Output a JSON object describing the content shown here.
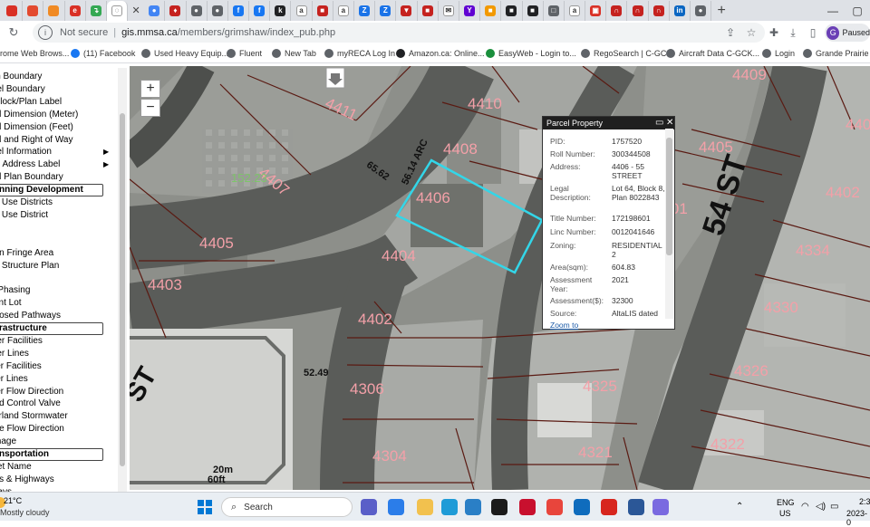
{
  "browser": {
    "url_prefix": "gis.mmsa.ca",
    "url_path": "/members/grimshaw/index_pub.php",
    "security_label": "Not secure",
    "profile_letter": "G",
    "profile_status": "Paused",
    "tabs": [
      {
        "icon": "bookmark-tab-icon",
        "color": "#d93025",
        "char": ""
      },
      {
        "icon": "red-tab-icon",
        "color": "#e34a2f",
        "char": ""
      },
      {
        "icon": "orange-tab-icon",
        "color": "#f08a24",
        "char": ""
      },
      {
        "icon": "red-e-tab-icon",
        "color": "#d93025",
        "char": "e"
      },
      {
        "icon": "green-tab-icon",
        "color": "#34a853",
        "char": "↴"
      },
      {
        "icon": "loading-tab-icon",
        "color": "#ffffff",
        "char": "◌"
      },
      {
        "icon": "maps-tab-icon",
        "color": "#4285f4",
        "char": "●"
      },
      {
        "icon": "red-leaf-tab-icon",
        "color": "#c5221f",
        "char": "♦"
      },
      {
        "icon": "grey-tab-icon",
        "color": "#5f6368",
        "char": "●"
      },
      {
        "icon": "grey-tab-icon",
        "color": "#5f6368",
        "char": "●"
      },
      {
        "icon": "facebook-tab-icon",
        "color": "#1877f2",
        "char": "f"
      },
      {
        "icon": "facebook-tab-icon",
        "color": "#1877f2",
        "char": "f"
      },
      {
        "icon": "k-tab-icon",
        "color": "#202124",
        "char": "k"
      },
      {
        "icon": "amazon-tab-icon",
        "color": "#ffffff",
        "char": "a"
      },
      {
        "icon": "red-square-tab-icon",
        "color": "#c5221f",
        "char": "■"
      },
      {
        "icon": "amazon-tab-icon",
        "color": "#ffffff",
        "char": "a"
      },
      {
        "icon": "z-tab-icon",
        "color": "#1a73e8",
        "char": "Z"
      },
      {
        "icon": "z-tab-icon",
        "color": "#1a73e8",
        "char": "Z"
      },
      {
        "icon": "triangle-tab-icon",
        "color": "#c5221f",
        "char": "▼"
      },
      {
        "icon": "red-square-tab-icon",
        "color": "#c5221f",
        "char": "■"
      },
      {
        "icon": "mail-tab-icon",
        "color": "#ffffff",
        "char": "✉"
      },
      {
        "icon": "yahoo-tab-icon",
        "color": "#6001d2",
        "char": "Y"
      },
      {
        "icon": "orange-square-tab-icon",
        "color": "#f29900",
        "char": "■"
      },
      {
        "icon": "cube-tab-icon",
        "color": "#202124",
        "char": "■"
      },
      {
        "icon": "cube-tab-icon",
        "color": "#202124",
        "char": "■"
      },
      {
        "icon": "doc-tab-icon",
        "color": "#5f6368",
        "char": "□"
      },
      {
        "icon": "amazon-tab-icon",
        "color": "#ffffff",
        "char": "a"
      },
      {
        "icon": "red-tab-icon",
        "color": "#d93025",
        "char": "▣"
      },
      {
        "icon": "red-arc-tab-icon",
        "color": "#c5221f",
        "char": "∩"
      },
      {
        "icon": "red-arc-tab-icon",
        "color": "#c5221f",
        "char": "∩"
      },
      {
        "icon": "red-arc-tab-icon",
        "color": "#c5221f",
        "char": "∩"
      },
      {
        "icon": "linkedin-tab-icon",
        "color": "#0a66c2",
        "char": "in"
      },
      {
        "icon": "globe-tab-icon",
        "color": "#5f6368",
        "char": "●"
      }
    ],
    "bookmarks": [
      {
        "label": "rome Web Brows...",
        "color": "#4285f4"
      },
      {
        "label": "(11) Facebook",
        "color": "#1877f2"
      },
      {
        "label": "Used Heavy Equip...",
        "color": "#5f6368"
      },
      {
        "label": "Fluent",
        "color": "#5f6368"
      },
      {
        "label": "New Tab",
        "color": "#5f6368"
      },
      {
        "label": "myRECA Log In",
        "color": "#5f6368"
      },
      {
        "label": "Amazon.ca: Online...",
        "color": "#202124"
      },
      {
        "label": "EasyWeb - Login to...",
        "color": "#1a8f3c"
      },
      {
        "label": "RegoSearch | C-GC...",
        "color": "#5f6368"
      },
      {
        "label": "Aircraft Data C-GCK...",
        "color": "#5f6368"
      },
      {
        "label": "Login",
        "color": "#5f6368"
      },
      {
        "label": "Grande Prairie",
        "color": "#5f6368"
      }
    ]
  },
  "layers": [
    {
      "label": "wn Boundary",
      "header": false,
      "arrow": false
    },
    {
      "label": "rcel Boundary",
      "header": false,
      "arrow": false
    },
    {
      "label": "t/Block/Plan Label",
      "header": false,
      "arrow": false
    },
    {
      "label": "gal Dimension (Meter)",
      "header": false,
      "arrow": false
    },
    {
      "label": "gal Dimension (Feet)",
      "header": false,
      "arrow": false
    },
    {
      "label": "gal and Right of Way",
      "header": false,
      "arrow": false
    },
    {
      "label": "rcel Information",
      "header": false,
      "arrow": true
    },
    {
      "label": "vic Address Label",
      "header": false,
      "arrow": true
    },
    {
      "label": "gal Plan Boundary",
      "header": false,
      "arrow": false
    },
    {
      "label": "nning Development",
      "header": true,
      "arrow": false
    },
    {
      "label": "nd Use Districts",
      "header": false,
      "arrow": false
    },
    {
      "label": "nd Use District",
      "header": false,
      "arrow": false
    },
    {
      "label": "ay",
      "header": false,
      "arrow": false
    },
    {
      "label": "P",
      "header": false,
      "arrow": false
    },
    {
      "label": "ban Fringe Area",
      "header": false,
      "arrow": false
    },
    {
      "label": "ea Structure Plan",
      "header": false,
      "arrow": false
    },
    {
      "label": "",
      "header": false,
      "arrow": false
    },
    {
      "label": "P Phasing",
      "header": false,
      "arrow": false
    },
    {
      "label": "cant Lot",
      "header": false,
      "arrow": false
    },
    {
      "label": "oposed Pathways",
      "header": false,
      "arrow": false
    },
    {
      "label": "rastructure",
      "header": true,
      "arrow": false
    },
    {
      "label": "ater Facilities",
      "header": false,
      "arrow": false
    },
    {
      "label": "ater Lines",
      "header": false,
      "arrow": false
    },
    {
      "label": "wer Facilities",
      "header": false,
      "arrow": false
    },
    {
      "label": "wer Lines",
      "header": false,
      "arrow": false
    },
    {
      "label": "wer Flow Direction",
      "header": false,
      "arrow": false
    },
    {
      "label": "ood Control Valve",
      "header": false,
      "arrow": false
    },
    {
      "label": "verland Stormwater",
      "header": false,
      "arrow": false
    },
    {
      "label": "age Flow Direction",
      "header": false,
      "arrow": false
    },
    {
      "label": "ainage",
      "header": false,
      "arrow": false
    },
    {
      "label": "nsportation",
      "header": true,
      "arrow": false
    },
    {
      "label": "reet Name",
      "header": false,
      "arrow": false
    },
    {
      "label": "ads & Highways",
      "header": false,
      "arrow": false
    },
    {
      "label": "lways",
      "header": false,
      "arrow": false
    }
  ],
  "map": {
    "zoom_in": "+",
    "zoom_out": "−",
    "street_label": "54 ST",
    "corner_street_label": "ST",
    "colors": {
      "parcel_line": "#5a1a12",
      "lot_label": "#f3a0a8",
      "selection": "#33d6e8",
      "road": "#5b5e5a"
    },
    "lot_labels": [
      {
        "text": "4411",
        "rot": 25
      },
      {
        "text": "4410",
        "rot": 0
      },
      {
        "text": "4409",
        "rot": 0
      },
      {
        "text": "4408",
        "rot": 0
      },
      {
        "text": "4407",
        "rot": 40
      },
      {
        "text": "4406",
        "rot": 0
      },
      {
        "text": "4405",
        "rot": 0
      },
      {
        "text": "4404",
        "rot": 0
      },
      {
        "text": "4403",
        "rot": 0
      },
      {
        "text": "4402",
        "rot": 0
      },
      {
        "text": "4306",
        "rot": 0
      },
      {
        "text": "4304",
        "rot": 0
      },
      {
        "text": "4325",
        "rot": 0
      },
      {
        "text": "4321",
        "rot": 0
      },
      {
        "text": "4405",
        "rot": 0
      },
      {
        "text": "4401",
        "rot": 0
      },
      {
        "text": "4402",
        "rot": 0
      },
      {
        "text": "4334",
        "rot": 0
      },
      {
        "text": "4330",
        "rot": 0
      },
      {
        "text": "4326",
        "rot": 0
      },
      {
        "text": "4322",
        "rot": 0
      },
      {
        "text": "440",
        "rot": 0
      }
    ],
    "dimensions": [
      "65.62",
      "56.14 ARC",
      "52.49",
      "20m",
      "60ft"
    ],
    "area_labels": [
      "152.23"
    ]
  },
  "popup": {
    "title": "Parcel Property",
    "rows": [
      {
        "key": "PID:",
        "value": "1757520"
      },
      {
        "key": "Roll Number:",
        "value": "300344508"
      },
      {
        "key": "Address:",
        "value": "4406 - 55 STREET"
      },
      {
        "key": "Legal Description:",
        "value": "Lot 64, Block 8, Plan 8022843"
      },
      {
        "key": "Title Number:",
        "value": "172198601"
      },
      {
        "key": "Linc Number:",
        "value": "0012041646"
      },
      {
        "key": "Zoning:",
        "value": "RESIDENTIAL 2"
      },
      {
        "key": "Area(sqm):",
        "value": "604.83"
      },
      {
        "key": "Assessment Year:",
        "value": "2021"
      },
      {
        "key": "Assessment($):",
        "value": "32300"
      },
      {
        "key": "Source:",
        "value": "AltaLIS dated"
      }
    ],
    "zoom_link": "Zoom to"
  },
  "taskbar": {
    "weather_temp": "21°C",
    "weather_desc": "Mostly cloudy",
    "search_label": "Search",
    "lang_top": "ENG",
    "lang_bottom": "US",
    "time": "2:3",
    "date": "2023-0"
  }
}
